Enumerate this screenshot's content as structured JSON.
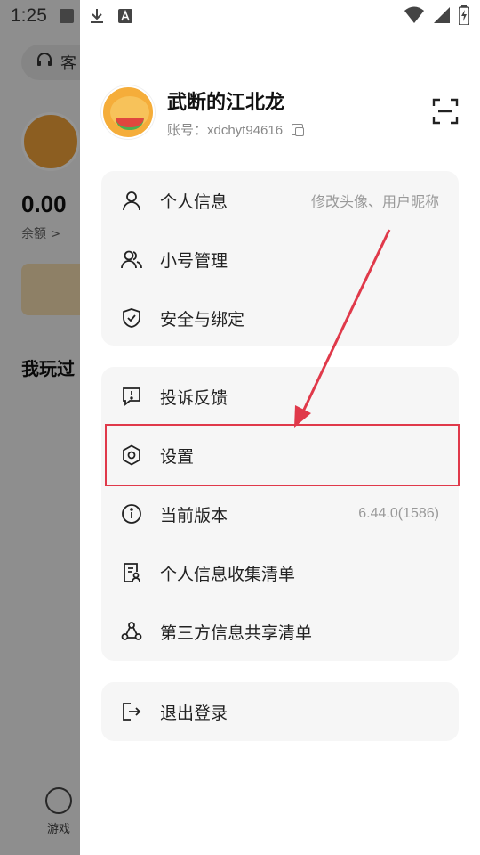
{
  "status_bar": {
    "time": "1:25"
  },
  "background_app": {
    "service_label": "客",
    "balance": "0.00",
    "balance_label": "余额 >",
    "section_title": "我玩过",
    "tab_games": "游戏"
  },
  "profile": {
    "name": "武断的江北龙",
    "account": "账号：xdchyt94616"
  },
  "menu_group_1": [
    {
      "label": "个人信息",
      "hint": "修改头像、用户昵称",
      "icon": "user-icon"
    },
    {
      "label": "小号管理",
      "hint": "",
      "icon": "users-icon"
    },
    {
      "label": "安全与绑定",
      "hint": "",
      "icon": "shield-check-icon"
    }
  ],
  "menu_group_2": [
    {
      "label": "投诉反馈",
      "hint": "",
      "icon": "feedback-icon"
    },
    {
      "label": "设置",
      "hint": "",
      "icon": "gear-icon"
    },
    {
      "label": "当前版本",
      "hint": "6.44.0(1586)",
      "icon": "info-icon"
    },
    {
      "label": "个人信息收集清单",
      "hint": "",
      "icon": "document-user-icon"
    },
    {
      "label": "第三方信息共享清单",
      "hint": "",
      "icon": "share-nodes-icon"
    }
  ],
  "menu_group_3": [
    {
      "label": "退出登录",
      "hint": "",
      "icon": "logout-icon"
    }
  ],
  "annotation_color": "#e0394a"
}
